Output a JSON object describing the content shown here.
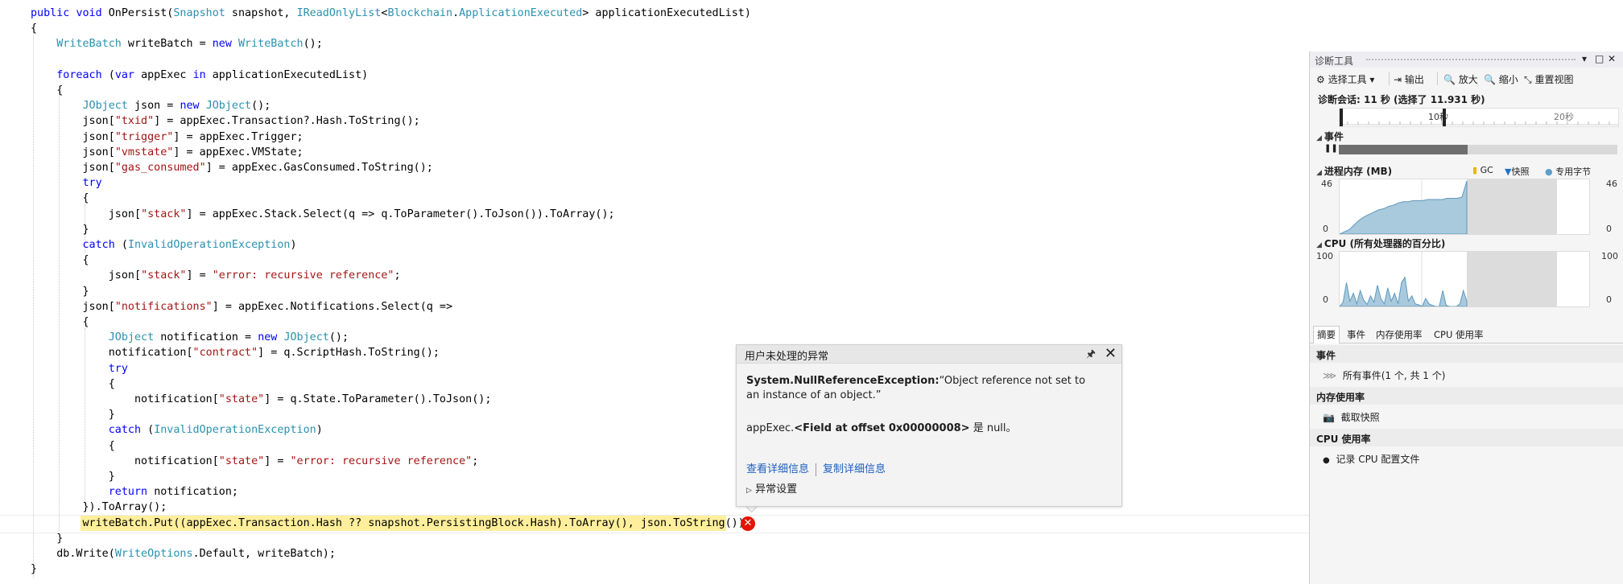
{
  "editor": {
    "lines": [
      [
        [
          "kw",
          "public "
        ],
        [
          "kw",
          "void "
        ],
        [
          "p",
          "OnPersist("
        ],
        [
          "ty",
          "Snapshot"
        ],
        [
          "p",
          " snapshot, "
        ],
        [
          "ty",
          "IReadOnlyList"
        ],
        [
          "p",
          "<"
        ],
        [
          "ty",
          "Blockchain"
        ],
        [
          "p",
          "."
        ],
        [
          "ty",
          "ApplicationExecuted"
        ],
        [
          "p",
          "> applicationExecutedList)"
        ]
      ],
      [
        [
          "p",
          "{"
        ]
      ],
      [
        [
          "p",
          "    "
        ],
        [
          "ty",
          "WriteBatch"
        ],
        [
          "p",
          " writeBatch = "
        ],
        [
          "kw",
          "new "
        ],
        [
          "ty",
          "WriteBatch"
        ],
        [
          "p",
          "();"
        ]
      ],
      [],
      [
        [
          "p",
          "    "
        ],
        [
          "kw",
          "foreach "
        ],
        [
          "p",
          "("
        ],
        [
          "kw",
          "var "
        ],
        [
          "p",
          "appExec "
        ],
        [
          "kw",
          "in "
        ],
        [
          "p",
          "applicationExecutedList)"
        ]
      ],
      [
        [
          "p",
          "    {"
        ]
      ],
      [
        [
          "p",
          "        "
        ],
        [
          "ty",
          "JObject"
        ],
        [
          "p",
          " json = "
        ],
        [
          "kw",
          "new "
        ],
        [
          "ty",
          "JObject"
        ],
        [
          "p",
          "();"
        ]
      ],
      [
        [
          "p",
          "        json["
        ],
        [
          "st",
          "\"txid\""
        ],
        [
          "p",
          "] = appExec.Transaction?.Hash.ToString();"
        ]
      ],
      [
        [
          "p",
          "        json["
        ],
        [
          "st",
          "\"trigger\""
        ],
        [
          "p",
          "] = appExec.Trigger;"
        ]
      ],
      [
        [
          "p",
          "        json["
        ],
        [
          "st",
          "\"vmstate\""
        ],
        [
          "p",
          "] = appExec.VMState;"
        ]
      ],
      [
        [
          "p",
          "        json["
        ],
        [
          "st",
          "\"gas_consumed\""
        ],
        [
          "p",
          "] = appExec.GasConsumed.ToString();"
        ]
      ],
      [
        [
          "p",
          "        "
        ],
        [
          "kw",
          "try"
        ]
      ],
      [
        [
          "p",
          "        {"
        ]
      ],
      [
        [
          "p",
          "            json["
        ],
        [
          "st",
          "\"stack\""
        ],
        [
          "p",
          "] = appExec.Stack.Select(q => q.ToParameter().ToJson()).ToArray();"
        ]
      ],
      [
        [
          "p",
          "        }"
        ]
      ],
      [
        [
          "p",
          "        "
        ],
        [
          "kw",
          "catch "
        ],
        [
          "p",
          "("
        ],
        [
          "ty",
          "InvalidOperationException"
        ],
        [
          "p",
          ")"
        ]
      ],
      [
        [
          "p",
          "        {"
        ]
      ],
      [
        [
          "p",
          "            json["
        ],
        [
          "st",
          "\"stack\""
        ],
        [
          "p",
          "] = "
        ],
        [
          "st",
          "\"error: recursive reference\""
        ],
        [
          "p",
          ";"
        ]
      ],
      [
        [
          "p",
          "        }"
        ]
      ],
      [
        [
          "p",
          "        json["
        ],
        [
          "st",
          "\"notifications\""
        ],
        [
          "p",
          "] = appExec.Notifications.Select(q =>"
        ]
      ],
      [
        [
          "p",
          "        {"
        ]
      ],
      [
        [
          "p",
          "            "
        ],
        [
          "ty",
          "JObject"
        ],
        [
          "p",
          " notification = "
        ],
        [
          "kw",
          "new "
        ],
        [
          "ty",
          "JObject"
        ],
        [
          "p",
          "();"
        ]
      ],
      [
        [
          "p",
          "            notification["
        ],
        [
          "st",
          "\"contract\""
        ],
        [
          "p",
          "] = q.ScriptHash.ToString();"
        ]
      ],
      [
        [
          "p",
          "            "
        ],
        [
          "kw",
          "try"
        ]
      ],
      [
        [
          "p",
          "            {"
        ]
      ],
      [
        [
          "p",
          "                notification["
        ],
        [
          "st",
          "\"state\""
        ],
        [
          "p",
          "] = q.State.ToParameter().ToJson();"
        ]
      ],
      [
        [
          "p",
          "            }"
        ]
      ],
      [
        [
          "p",
          "            "
        ],
        [
          "kw",
          "catch "
        ],
        [
          "p",
          "("
        ],
        [
          "ty",
          "InvalidOperationException"
        ],
        [
          "p",
          ")"
        ]
      ],
      [
        [
          "p",
          "            {"
        ]
      ],
      [
        [
          "p",
          "                notification["
        ],
        [
          "st",
          "\"state\""
        ],
        [
          "p",
          "] = "
        ],
        [
          "st",
          "\"error: recursive reference\""
        ],
        [
          "p",
          ";"
        ]
      ],
      [
        [
          "p",
          "            }"
        ]
      ],
      [
        [
          "p",
          "            "
        ],
        [
          "kw",
          "return "
        ],
        [
          "p",
          "notification;"
        ]
      ],
      [
        [
          "p",
          "        }).ToArray();"
        ]
      ],
      [
        [
          "p",
          "        writeBatch.Put((appExec.Transaction.Hash ?? snapshot.PersistingBlock.Hash).ToArray(), json.ToString());"
        ]
      ],
      [
        [
          "p",
          "    }"
        ]
      ],
      [
        [
          "p",
          "    db.Write("
        ],
        [
          "ty",
          "WriteOptions"
        ],
        [
          "p",
          ".Default, writeBatch);"
        ]
      ],
      [
        [
          "p",
          "}"
        ]
      ]
    ],
    "error_glyph": "✕"
  },
  "exception": {
    "title": "用户未处理的异常",
    "pin_icon": "🖈",
    "close_icon": "✕",
    "type": "System.NullReferenceException:",
    "message": "“Object reference not set to an instance of an object.”",
    "detail_prefix": "appExec.",
    "detail_bold": "<Field at offset 0x00000008>",
    "detail_suffix": " 是 null。",
    "link_details": "查看详细信息",
    "link_copy": "复制详细信息",
    "settings": "异常设置"
  },
  "diag": {
    "title": "诊断工具",
    "controls": [
      "▾",
      "□",
      "✕"
    ],
    "toolbar": {
      "select_tools": "选择工具 ▾",
      "output": "输出",
      "zoom_in": "放大",
      "zoom_out": "缩小",
      "reset_view": "重置视图"
    },
    "session": "诊断会话: 11 秒 (选择了 11.931 秒)",
    "ruler_ticks": [
      "10秒",
      "20秒"
    ],
    "events_label": "事件",
    "memory": {
      "label": "进程内存 (MB)",
      "legend_gc": "GC",
      "legend_snapshot": "快照",
      "legend_private": "专用字节",
      "max": "46",
      "min": "0",
      "values": [
        0,
        2,
        4,
        8,
        12,
        15,
        17,
        19,
        21,
        22,
        24,
        25,
        27,
        28,
        28,
        29,
        29,
        29,
        30,
        30,
        30,
        30,
        31,
        31,
        31,
        32,
        46
      ],
      "ymax": 46
    },
    "cpu": {
      "label": "CPU (所有处理器的百分比)",
      "max": "100",
      "min": "0",
      "values": [
        0,
        8,
        45,
        10,
        25,
        5,
        30,
        12,
        4,
        20,
        8,
        40,
        15,
        5,
        35,
        10,
        25,
        5,
        45,
        55,
        10,
        20,
        5,
        3,
        0,
        15,
        5,
        2,
        0,
        0,
        30,
        2,
        0,
        0,
        0,
        5,
        30,
        10
      ],
      "ymax": 100
    },
    "tabs": [
      "摘要",
      "事件",
      "内存使用率",
      "CPU 使用率"
    ],
    "section_events": "事件",
    "all_events": "所有事件(1 个, 共 1 个)",
    "section_memory": "内存使用率",
    "take_snapshot": "截取快照",
    "section_cpu": "CPU 使用率",
    "record_cpu": "记录 CPU 配置文件",
    "colors": {
      "chart_fill": "#a9c9dc",
      "chart_line": "#5d99bf",
      "gc": "#f0b400",
      "snapshot": "#1e74c8",
      "private": "#5d9fc9"
    }
  }
}
